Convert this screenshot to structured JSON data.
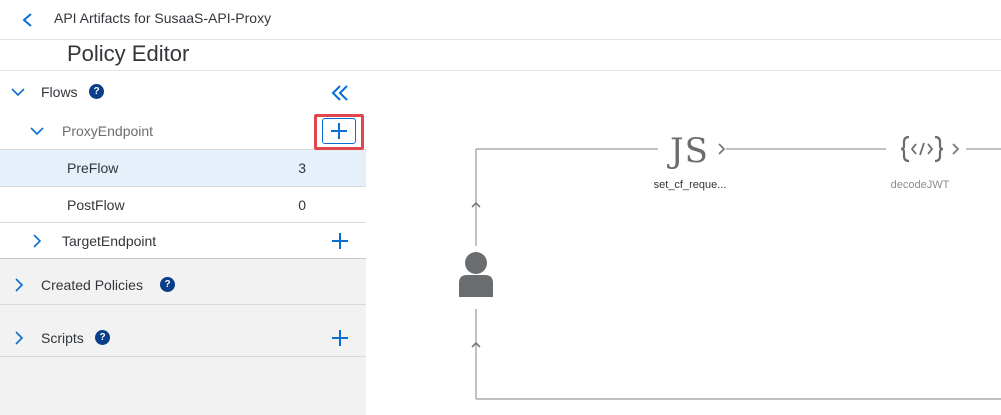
{
  "topbar": {
    "title": "API Artifacts for SusaaS-API-Proxy"
  },
  "header": {
    "title": "Policy Editor"
  },
  "sidebar": {
    "flows_label": "Flows",
    "proxy_endpoint_label": "ProxyEndpoint",
    "preflow_label": "PreFlow",
    "preflow_count": "3",
    "postflow_label": "PostFlow",
    "postflow_count": "0",
    "target_endpoint_label": "TargetEndpoint",
    "created_policies_label": "Created Policies",
    "scripts_label": "Scripts"
  },
  "canvas": {
    "policies": [
      {
        "label": "set_cf_reque...",
        "icon": "javascript-icon",
        "glyph": "JS"
      },
      {
        "label": "decodeJWT",
        "icon": "code-brackets-icon"
      }
    ]
  },
  "colors": {
    "accent": "#0a6ed1",
    "help_badge": "#0a3d8a",
    "highlight_border": "#e0474c",
    "selected_row": "#e5f0fa"
  }
}
